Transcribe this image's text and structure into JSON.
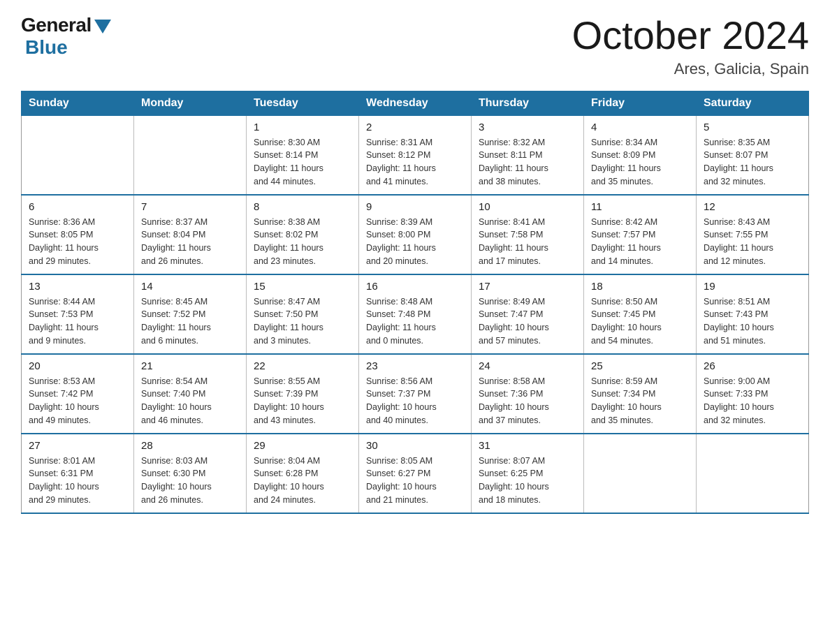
{
  "logo": {
    "general": "General",
    "blue": "Blue"
  },
  "title": "October 2024",
  "location": "Ares, Galicia, Spain",
  "days_of_week": [
    "Sunday",
    "Monday",
    "Tuesday",
    "Wednesday",
    "Thursday",
    "Friday",
    "Saturday"
  ],
  "weeks": [
    [
      {
        "day": "",
        "info": ""
      },
      {
        "day": "",
        "info": ""
      },
      {
        "day": "1",
        "info": "Sunrise: 8:30 AM\nSunset: 8:14 PM\nDaylight: 11 hours\nand 44 minutes."
      },
      {
        "day": "2",
        "info": "Sunrise: 8:31 AM\nSunset: 8:12 PM\nDaylight: 11 hours\nand 41 minutes."
      },
      {
        "day": "3",
        "info": "Sunrise: 8:32 AM\nSunset: 8:11 PM\nDaylight: 11 hours\nand 38 minutes."
      },
      {
        "day": "4",
        "info": "Sunrise: 8:34 AM\nSunset: 8:09 PM\nDaylight: 11 hours\nand 35 minutes."
      },
      {
        "day": "5",
        "info": "Sunrise: 8:35 AM\nSunset: 8:07 PM\nDaylight: 11 hours\nand 32 minutes."
      }
    ],
    [
      {
        "day": "6",
        "info": "Sunrise: 8:36 AM\nSunset: 8:05 PM\nDaylight: 11 hours\nand 29 minutes."
      },
      {
        "day": "7",
        "info": "Sunrise: 8:37 AM\nSunset: 8:04 PM\nDaylight: 11 hours\nand 26 minutes."
      },
      {
        "day": "8",
        "info": "Sunrise: 8:38 AM\nSunset: 8:02 PM\nDaylight: 11 hours\nand 23 minutes."
      },
      {
        "day": "9",
        "info": "Sunrise: 8:39 AM\nSunset: 8:00 PM\nDaylight: 11 hours\nand 20 minutes."
      },
      {
        "day": "10",
        "info": "Sunrise: 8:41 AM\nSunset: 7:58 PM\nDaylight: 11 hours\nand 17 minutes."
      },
      {
        "day": "11",
        "info": "Sunrise: 8:42 AM\nSunset: 7:57 PM\nDaylight: 11 hours\nand 14 minutes."
      },
      {
        "day": "12",
        "info": "Sunrise: 8:43 AM\nSunset: 7:55 PM\nDaylight: 11 hours\nand 12 minutes."
      }
    ],
    [
      {
        "day": "13",
        "info": "Sunrise: 8:44 AM\nSunset: 7:53 PM\nDaylight: 11 hours\nand 9 minutes."
      },
      {
        "day": "14",
        "info": "Sunrise: 8:45 AM\nSunset: 7:52 PM\nDaylight: 11 hours\nand 6 minutes."
      },
      {
        "day": "15",
        "info": "Sunrise: 8:47 AM\nSunset: 7:50 PM\nDaylight: 11 hours\nand 3 minutes."
      },
      {
        "day": "16",
        "info": "Sunrise: 8:48 AM\nSunset: 7:48 PM\nDaylight: 11 hours\nand 0 minutes."
      },
      {
        "day": "17",
        "info": "Sunrise: 8:49 AM\nSunset: 7:47 PM\nDaylight: 10 hours\nand 57 minutes."
      },
      {
        "day": "18",
        "info": "Sunrise: 8:50 AM\nSunset: 7:45 PM\nDaylight: 10 hours\nand 54 minutes."
      },
      {
        "day": "19",
        "info": "Sunrise: 8:51 AM\nSunset: 7:43 PM\nDaylight: 10 hours\nand 51 minutes."
      }
    ],
    [
      {
        "day": "20",
        "info": "Sunrise: 8:53 AM\nSunset: 7:42 PM\nDaylight: 10 hours\nand 49 minutes."
      },
      {
        "day": "21",
        "info": "Sunrise: 8:54 AM\nSunset: 7:40 PM\nDaylight: 10 hours\nand 46 minutes."
      },
      {
        "day": "22",
        "info": "Sunrise: 8:55 AM\nSunset: 7:39 PM\nDaylight: 10 hours\nand 43 minutes."
      },
      {
        "day": "23",
        "info": "Sunrise: 8:56 AM\nSunset: 7:37 PM\nDaylight: 10 hours\nand 40 minutes."
      },
      {
        "day": "24",
        "info": "Sunrise: 8:58 AM\nSunset: 7:36 PM\nDaylight: 10 hours\nand 37 minutes."
      },
      {
        "day": "25",
        "info": "Sunrise: 8:59 AM\nSunset: 7:34 PM\nDaylight: 10 hours\nand 35 minutes."
      },
      {
        "day": "26",
        "info": "Sunrise: 9:00 AM\nSunset: 7:33 PM\nDaylight: 10 hours\nand 32 minutes."
      }
    ],
    [
      {
        "day": "27",
        "info": "Sunrise: 8:01 AM\nSunset: 6:31 PM\nDaylight: 10 hours\nand 29 minutes."
      },
      {
        "day": "28",
        "info": "Sunrise: 8:03 AM\nSunset: 6:30 PM\nDaylight: 10 hours\nand 26 minutes."
      },
      {
        "day": "29",
        "info": "Sunrise: 8:04 AM\nSunset: 6:28 PM\nDaylight: 10 hours\nand 24 minutes."
      },
      {
        "day": "30",
        "info": "Sunrise: 8:05 AM\nSunset: 6:27 PM\nDaylight: 10 hours\nand 21 minutes."
      },
      {
        "day": "31",
        "info": "Sunrise: 8:07 AM\nSunset: 6:25 PM\nDaylight: 10 hours\nand 18 minutes."
      },
      {
        "day": "",
        "info": ""
      },
      {
        "day": "",
        "info": ""
      }
    ]
  ]
}
